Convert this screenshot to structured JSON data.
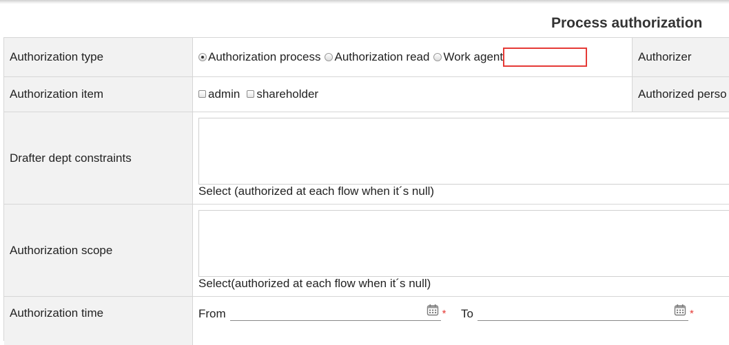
{
  "page": {
    "title": "Process authorization"
  },
  "rows": {
    "type": {
      "label": "Authorization type",
      "options": [
        "Authorization process",
        "Authorization read",
        "Work agent"
      ],
      "selected": "Authorization process",
      "side_label": "Authorizer"
    },
    "item": {
      "label": "Authorization item",
      "options": [
        "admin",
        "shareholder"
      ],
      "side_label": "Authorized perso"
    },
    "drafter": {
      "label": "Drafter dept constraints",
      "select_text": "Select (authorized at each flow when it´s null)"
    },
    "scope": {
      "label": "Authorization scope",
      "select_text": "Select(authorized at each flow when it´s null)"
    },
    "time": {
      "label": "Authorization time",
      "from_label": "From",
      "to_label": "To",
      "required_mark": "*"
    }
  },
  "icons": {
    "calendar": "calendar-icon"
  },
  "colors": {
    "label_bg": "#f2f2f2",
    "border": "#d6d6d6",
    "highlight": "#e53935",
    "required": "#e53935"
  }
}
